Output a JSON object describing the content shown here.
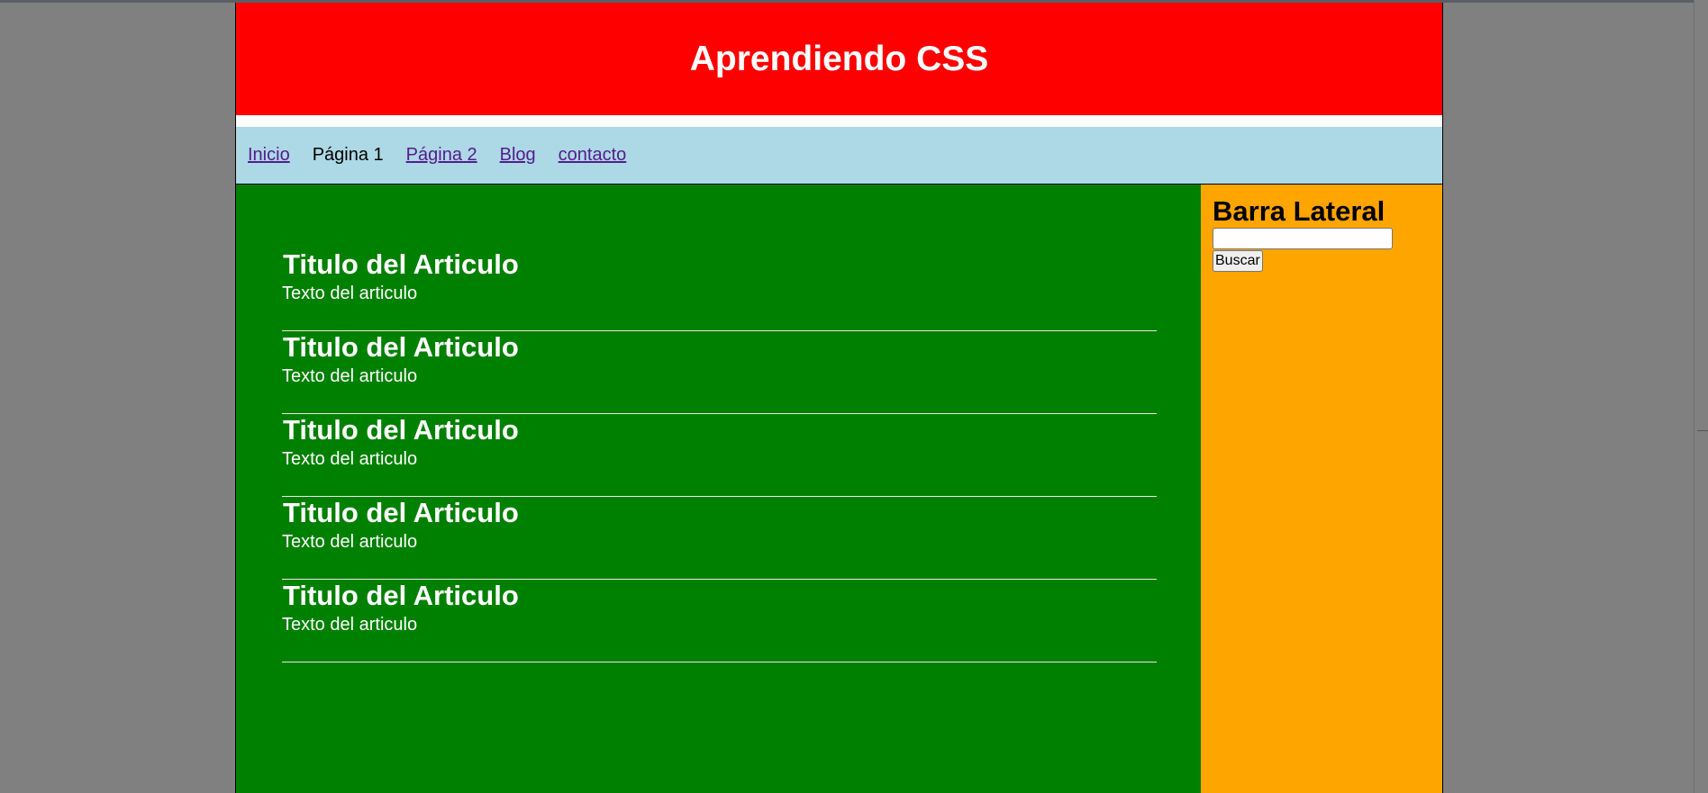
{
  "header": {
    "title": "Aprendiendo CSS"
  },
  "nav": {
    "items": [
      {
        "label": "Inicio",
        "link": true
      },
      {
        "label": "Página 1",
        "link": false
      },
      {
        "label": "Página 2",
        "link": true
      },
      {
        "label": "Blog",
        "link": true
      },
      {
        "label": "contacto",
        "link": true
      }
    ]
  },
  "articles": [
    {
      "title": "Titulo del Articulo",
      "text": "Texto del articulo"
    },
    {
      "title": "Titulo del Articulo",
      "text": "Texto del articulo"
    },
    {
      "title": "Titulo del Articulo",
      "text": "Texto del articulo"
    },
    {
      "title": "Titulo del Articulo",
      "text": "Texto del articulo"
    },
    {
      "title": "Titulo del Articulo",
      "text": "Texto del articulo"
    }
  ],
  "sidebar": {
    "title": "Barra Lateral",
    "search_value": "",
    "search_button": "Buscar"
  },
  "colors": {
    "background": "#808080",
    "header": "#ff0000",
    "nav": "#add8e6",
    "main": "#008000",
    "sidebar": "#ffa500",
    "link": "#551a8b"
  }
}
